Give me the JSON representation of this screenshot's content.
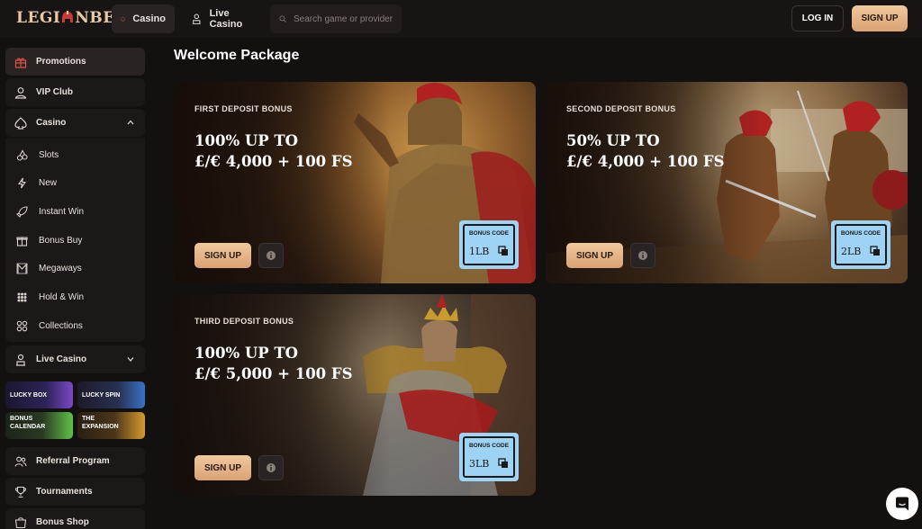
{
  "header": {
    "logo_text_left": "LEGI",
    "logo_text_right": "NBET",
    "nav": [
      {
        "label": "Casino",
        "icon": "spade-icon",
        "active": true
      },
      {
        "label": "Live Casino",
        "icon": "dealer-icon",
        "active": false
      }
    ],
    "search": {
      "placeholder": "Search game or provider",
      "value": ""
    },
    "login_label": "LOG IN",
    "signup_label": "SIGN UP"
  },
  "sidebar": {
    "items": [
      {
        "label": "Promotions",
        "icon": "gift-icon"
      },
      {
        "label": "VIP Club",
        "icon": "user-icon"
      },
      {
        "label": "Casino",
        "icon": "spade-icon",
        "expanded": true
      }
    ],
    "casino_sub": [
      {
        "label": "Slots",
        "icon": "cherries-icon"
      },
      {
        "label": "New",
        "icon": "lightning-icon"
      },
      {
        "label": "Instant Win",
        "icon": "rocket-icon"
      },
      {
        "label": "Bonus Buy",
        "icon": "gift-box-icon"
      },
      {
        "label": "Megaways",
        "icon": "megaways-icon"
      },
      {
        "label": "Hold & Win",
        "icon": "grid-dots-icon"
      },
      {
        "label": "Collections",
        "icon": "collections-icon"
      }
    ],
    "live_casino": {
      "label": "Live Casino",
      "icon": "dealer-icon",
      "expanded": false
    },
    "promo_tiles": [
      {
        "label": "LUCKY BOX"
      },
      {
        "label": "LUCKY SPIN"
      },
      {
        "label_line1": "BONUS",
        "label_line2": "CALENDAR"
      },
      {
        "label_line1": "THE",
        "label_line2": "EXPANSION"
      }
    ],
    "bottom_items": [
      {
        "label": "Referral Program",
        "icon": "users-icon"
      },
      {
        "label": "Tournaments",
        "icon": "trophy-icon"
      },
      {
        "label": "Bonus Shop",
        "icon": "shop-icon"
      }
    ]
  },
  "main": {
    "title": "Welcome Package",
    "cards": [
      {
        "label": "FIRST DEPOSIT BONUS",
        "line1": "100% UP TO",
        "line2": "£/€ 4,000 + 100 FS",
        "signup": "SIGN UP",
        "bonus_title": "BONUS CODE",
        "bonus_code": "1LB"
      },
      {
        "label": "SECOND DEPOSIT BONUS",
        "line1": "50% UP TO",
        "line2": "£/€ 4,000 + 100 FS",
        "signup": "SIGN UP",
        "bonus_title": "BONUS CODE",
        "bonus_code": "2LB"
      },
      {
        "label": "THIRD DEPOSIT BONUS",
        "line1": "100% UP TO",
        "line2": "£/€ 5,000 + 100 FS",
        "signup": "SIGN UP",
        "bonus_title": "BONUS CODE",
        "bonus_code": "3LB"
      }
    ]
  },
  "colors": {
    "accent": "#e0ad80",
    "background": "#131010",
    "panel": "#1d1818",
    "promo_icon_red": "#e0524a",
    "bonus_code_bg": "#9fd3f5"
  }
}
